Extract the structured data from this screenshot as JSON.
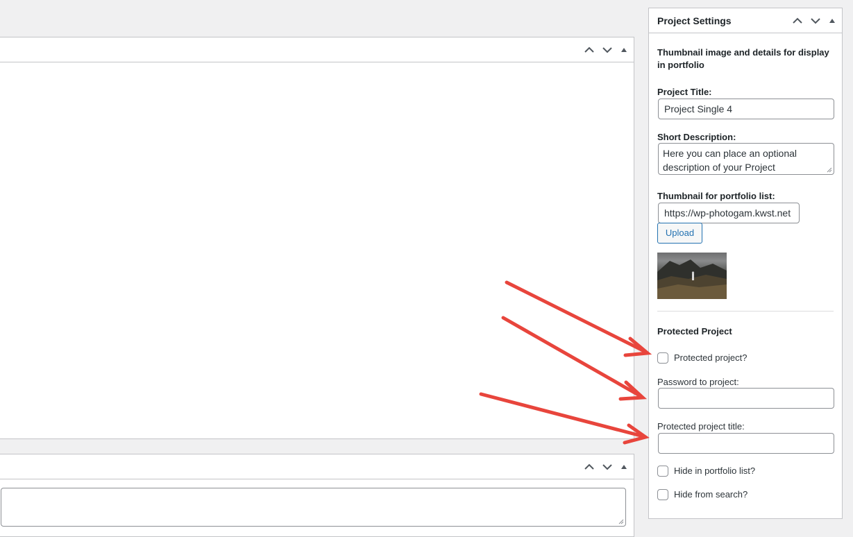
{
  "main_boxes": [
    {
      "name": "content-box"
    },
    {
      "name": "bottom-box"
    }
  ],
  "sidebar": {
    "title": "Project Settings",
    "intro": "Thumbnail image and details for display in portfolio",
    "fields": {
      "project_title_label": "Project Title:",
      "project_title_value": "Project Single 4",
      "short_desc_label": "Short Description:",
      "short_desc_value": "Here you can place an optional description of your  Project",
      "thumb_label": "Thumbnail for portfolio list:",
      "thumb_value": "https://wp-photogam.kwst.net",
      "upload_label": "Upload"
    },
    "protected": {
      "heading": "Protected Project",
      "protected_checkbox_label": "Protected project?",
      "password_label": "Password to project:",
      "password_value": "",
      "title_label": "Protected project title:",
      "title_value": "",
      "hide_portfolio_label": "Hide in portfolio list?",
      "hide_search_label": "Hide from search?"
    }
  },
  "colors": {
    "background": "#f0f0f1",
    "border": "#c3c4c7",
    "accent": "#2271b1",
    "annotation_arrow": "#e8453c"
  },
  "icons": [
    "chevron-up-icon",
    "chevron-down-icon",
    "triangle-up-icon"
  ]
}
